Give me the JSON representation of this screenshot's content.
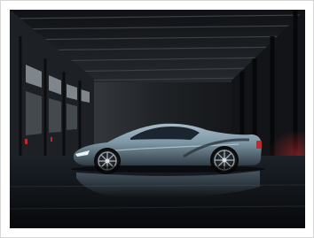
{
  "image": {
    "subject": "electric-hypercar-in-warehouse",
    "border_color": "#d6d6d6",
    "car_color": "#7f98a6",
    "accent_light_color": "#c0282e"
  }
}
